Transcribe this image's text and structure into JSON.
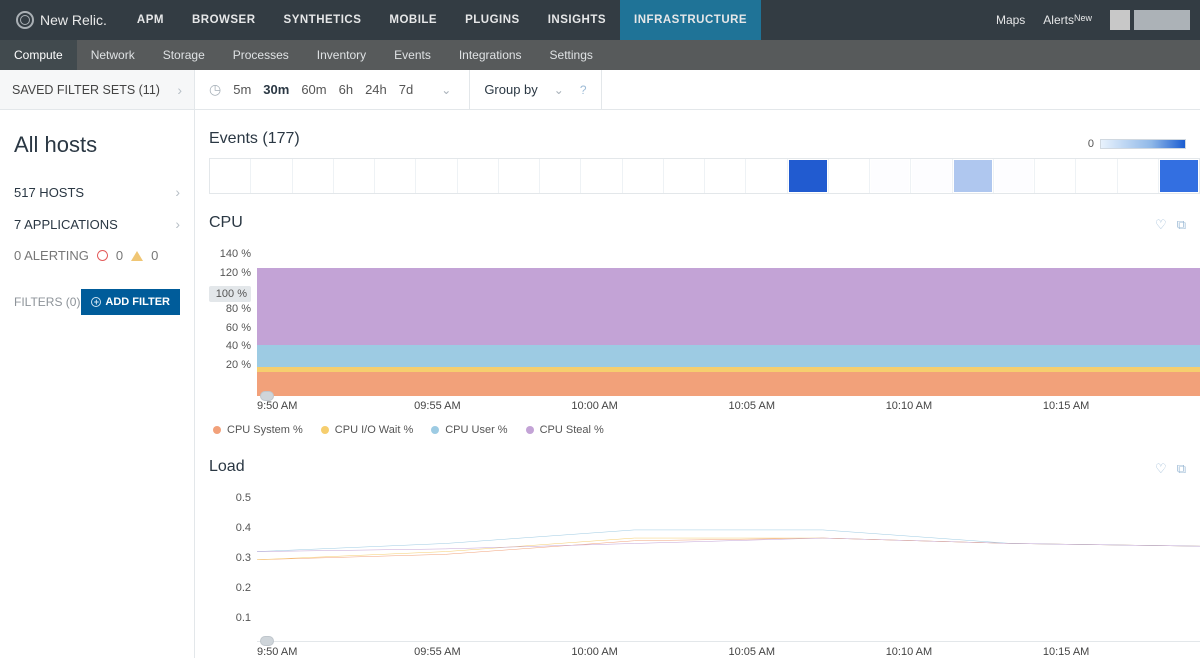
{
  "brand": "New Relic.",
  "topnav": [
    "APM",
    "BROWSER",
    "SYNTHETICS",
    "MOBILE",
    "PLUGINS",
    "INSIGHTS",
    "INFRASTRUCTURE"
  ],
  "topnav_active": 6,
  "top_right": {
    "maps": "Maps",
    "alerts": "Alerts",
    "alerts_badge": "New"
  },
  "subnav": [
    "Compute",
    "Network",
    "Storage",
    "Processes",
    "Inventory",
    "Events",
    "Integrations",
    "Settings"
  ],
  "subnav_active": 0,
  "sidebar": {
    "saved_filter_sets_label": "SAVED FILTER SETS (11)",
    "title": "All hosts",
    "hosts": "517 HOSTS",
    "apps": "7 APPLICATIONS",
    "alerting_label": "0 ALERTING",
    "alerting_crit": "0",
    "alerting_warn": "0",
    "filters_label": "FILTERS (0)",
    "add_filter": "ADD FILTER"
  },
  "toolbar": {
    "windows": [
      "5m",
      "30m",
      "60m",
      "6h",
      "24h",
      "7d"
    ],
    "active_window": 1,
    "group_by": "Group by"
  },
  "events": {
    "title": "Events (177)",
    "scale_min": "0",
    "cells": [
      null,
      null,
      null,
      null,
      null,
      null,
      null,
      null,
      null,
      null,
      null,
      null,
      null,
      null,
      "#215bd0",
      null,
      "#fdfdff",
      "#fdfdff",
      "#afc7ef",
      "#fdfdff",
      null,
      null,
      null,
      "#336fe1"
    ]
  },
  "cpu": {
    "title": "CPU",
    "yticks": [
      "140 %",
      "120 %",
      "100 %",
      "80 %",
      "60 %",
      "40 %",
      "20 %"
    ],
    "xticks": [
      "9:50 AM",
      "09:55 AM",
      "10:00 AM",
      "10:05 AM",
      "10:10 AM",
      "10:15 AM"
    ],
    "legend": [
      "CPU System %",
      "CPU I/O Wait %",
      "CPU User %",
      "CPU Steal %"
    ]
  },
  "load": {
    "title": "Load",
    "yticks": [
      "0.5",
      "0.4",
      "0.3",
      "0.2",
      "0.1"
    ],
    "xticks": [
      "9:50 AM",
      "09:55 AM",
      "10:00 AM",
      "10:05 AM",
      "10:10 AM",
      "10:15 AM"
    ]
  },
  "chart_data": [
    {
      "type": "area",
      "name": "CPU",
      "x": [
        "9:50",
        "9:55",
        "10:00",
        "10:05",
        "10:10",
        "10:15"
      ],
      "ylim": [
        0,
        140
      ],
      "series_stacked": true,
      "series": [
        {
          "name": "CPU System %",
          "color": "#f2a17a",
          "values": [
            22,
            22,
            23,
            24,
            23,
            23
          ]
        },
        {
          "name": "CPU I/O Wait %",
          "color": "#f6ce6e",
          "values": [
            5,
            5,
            5,
            5,
            5,
            5
          ]
        },
        {
          "name": "CPU User %",
          "color": "#9dcbe3",
          "values": [
            20,
            20,
            21,
            21,
            20,
            20
          ]
        },
        {
          "name": "CPU Steal %",
          "color": "#c3a3d6",
          "values": [
            68,
            70,
            73,
            75,
            76,
            78
          ]
        }
      ]
    },
    {
      "type": "line",
      "name": "Load",
      "x": [
        "9:50",
        "9:55",
        "10:00",
        "10:05",
        "10:10",
        "10:15"
      ],
      "ylim": [
        0,
        0.55
      ],
      "series": [
        {
          "name": "orange",
          "color": "#f2a17a",
          "values": [
            0.3,
            0.32,
            0.37,
            0.38,
            0.36,
            0.35
          ]
        },
        {
          "name": "yellow",
          "color": "#f6ce6e",
          "values": [
            0.3,
            0.33,
            0.38,
            0.38,
            0.36,
            0.35
          ]
        },
        {
          "name": "blue",
          "color": "#9dcbe3",
          "values": [
            0.33,
            0.36,
            0.41,
            0.41,
            0.36,
            0.35
          ]
        },
        {
          "name": "purple",
          "color": "#c3a3d6",
          "values": [
            0.33,
            0.34,
            0.36,
            0.38,
            0.36,
            0.35
          ]
        }
      ]
    }
  ]
}
